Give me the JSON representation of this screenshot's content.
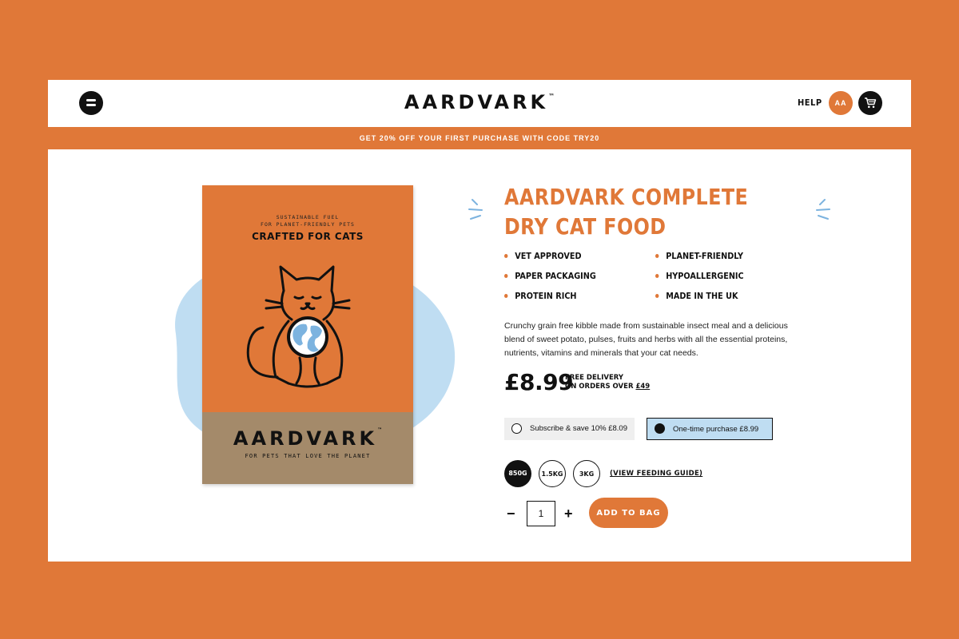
{
  "header": {
    "logo": "AARDVARK",
    "logo_tm": "™",
    "menu_icon": "hamburger-icon",
    "help_label": "HELP",
    "account_label": "AA",
    "cart_icon": "cart-icon"
  },
  "promo": {
    "text": "GET 20% OFF YOUR FIRST PURCHASE WITH CODE TRY20"
  },
  "product_image": {
    "small_line1": "SUSTAINABLE FUEL",
    "small_line2": "FOR PLANET-FRIENDLY PETS",
    "crafted": "CRAFTED FOR CATS",
    "brand": "AARDVARK",
    "brand_tm": "™",
    "tagline": "FOR PETS THAT LOVE THE PLANET"
  },
  "product": {
    "title": "AARDVARK COMPLETE DRY CAT FOOD",
    "features": [
      "VET APPROVED",
      "PLANET-FRIENDLY",
      "PAPER PACKAGING",
      "HYPOALLERGENIC",
      "PROTEIN RICH",
      "MADE IN THE UK"
    ],
    "description": "Crunchy grain free kibble made from sustainable insect meal and a delicious blend of sweet potato, pulses, fruits and herbs with all the essential proteins, nutrients, vitamins and minerals that your cat needs.",
    "price": "£8.99",
    "delivery_line1": "FREE DELIVERY",
    "delivery_line2": "ON ORDERS OVER",
    "delivery_threshold": "£49",
    "purchase_options": [
      {
        "label": "Subscribe & save 10% £8.09",
        "selected": false
      },
      {
        "label": "One-time purchase £8.99",
        "selected": true
      }
    ],
    "sizes": [
      {
        "label": "850G",
        "selected": true
      },
      {
        "label": "1.5KG",
        "selected": false
      },
      {
        "label": "3KG",
        "selected": false
      }
    ],
    "feeding_guide": "(VIEW FEEDING GUIDE)",
    "qty_minus": "−",
    "qty_value": "1",
    "qty_plus": "+",
    "add_to_bag": "ADD TO BAG"
  },
  "colors": {
    "accent": "#E07838",
    "dark": "#111111",
    "light_blue": "#BFDDF2",
    "kraft": "#A48A6A"
  }
}
